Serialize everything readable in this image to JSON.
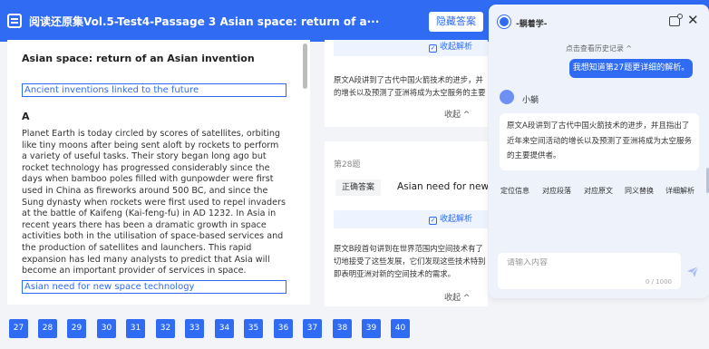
{
  "header": {
    "title": "阅读还原集Vol.5-Test4-Passage 3 Asian space: return of a···",
    "hide_answer_label": "隐藏答案"
  },
  "passage": {
    "title": "Asian space: return of an Asian invention",
    "heading1": "Ancient inventions linked to the future",
    "para_label": "A",
    "para_text": "Planet Earth is today circled by scores of satellites, orbiting like tiny moons after being sent aloft by rockets to perform a variety of useful tasks. Their story began long ago but rocket technology has progressed considerably since the days when bamboo poles filled with gunpowder were first used in China as fireworks around 500 BC, and since the Sung dynasty when rockets were first used to repel invaders at the battle of Kaifeng (Kai-feng-fu) in AD 1232. In Asia in recent years there has been a dramatic growth in space activities both in the utilisation of space-based services and the production of satellites and launchers. This rapid expansion has led many analysts to predict that Asia will become an important provider of services in space.",
    "heading2": "Asian need for new space technology"
  },
  "cards": {
    "collapse_analysis_label": "收起解析",
    "collapse_label": "收起",
    "card1_line1": "原文A段讲到了古代中国火箭技术的进步，并",
    "card1_line2": "的增长以及预测了亚洲将成为太空服务的主要",
    "card2_qnum": "第28题",
    "card2_correct_label": "正确答案",
    "card2_correct_value": "Asian need for new sp",
    "card2_line1": "原文B段首句讲到在世界范围内空间技术有了",
    "card2_line2": "切地接受了这些发展，它们发现这些技术特别",
    "card2_line3": "即表明亚洲对新的空间技术的需求。"
  },
  "chat": {
    "title": "-躺着学-",
    "history_label": "点击查看历史记录 ^",
    "user_message": "我想知道第27题更详细的解析。",
    "bot_name": "小躺",
    "bot_message": "原文A段讲到了古代中国火箭技术的进步，并且指出了近年来空间活动的增长以及预测了亚洲将成为太空服务的主要提供者。",
    "chips": [
      "定位信息",
      "对应段落",
      "对应原文",
      "同义替换",
      "详细解析"
    ],
    "input_placeholder": "请输入内容",
    "char_count": "0 / 1000"
  },
  "pager": {
    "pages": [
      "27",
      "28",
      "29",
      "30",
      "31",
      "32",
      "33",
      "34",
      "35",
      "36",
      "37",
      "38",
      "39",
      "40"
    ]
  }
}
